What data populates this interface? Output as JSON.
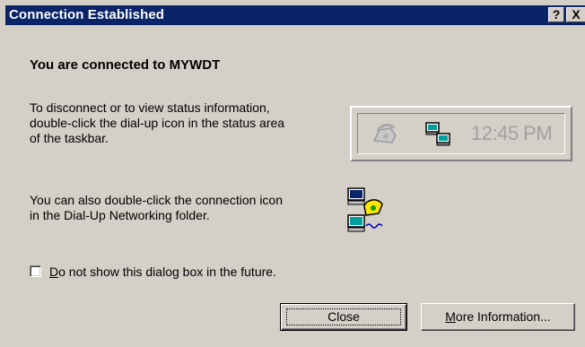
{
  "window": {
    "title": "Connection Established",
    "help_button": "?",
    "close_button": "X"
  },
  "heading": "You are connected to MYWDT",
  "instructions": {
    "line1": "To disconnect or to view status information,",
    "line2": "double-click the dial-up icon in the status area",
    "line3": "of the taskbar."
  },
  "tray_preview": {
    "time": "12:45 PM",
    "icons": [
      "phone-icon",
      "dialup-connection-icon"
    ]
  },
  "alternate": {
    "line1": "You can also double-click the connection icon",
    "line2": "in the Dial-Up Networking folder.",
    "icon": "dialup-networking-icon"
  },
  "checkbox": {
    "label_underlined": "D",
    "label_rest": "o not show this dialog box in the future.",
    "checked": false
  },
  "buttons": {
    "close": "Close",
    "more_info_underlined": "M",
    "more_info_rest": "ore Information..."
  }
}
